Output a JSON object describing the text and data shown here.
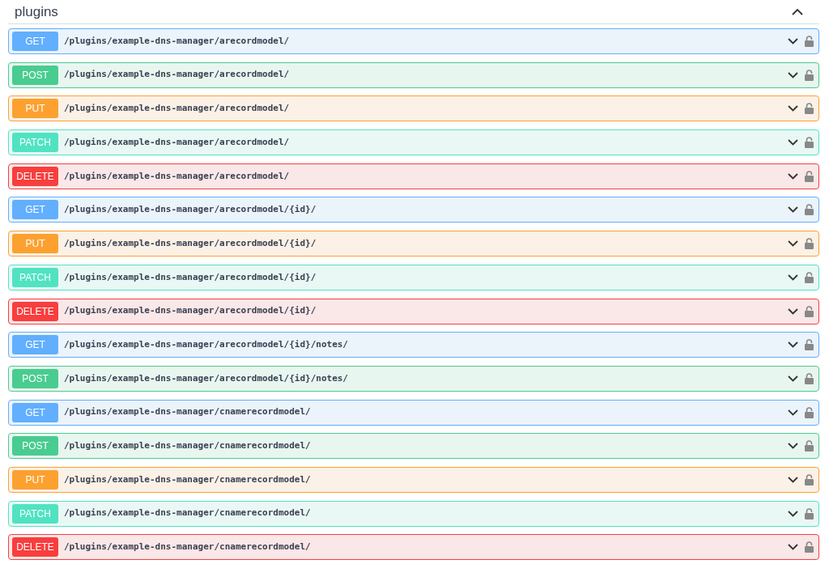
{
  "section": {
    "title": "plugins",
    "expanded": true
  },
  "operations": [
    {
      "kind": "get",
      "method": "GET",
      "path": "/plugins/example-dns-manager/arecordmodel/"
    },
    {
      "kind": "post",
      "method": "POST",
      "path": "/plugins/example-dns-manager/arecordmodel/"
    },
    {
      "kind": "put",
      "method": "PUT",
      "path": "/plugins/example-dns-manager/arecordmodel/"
    },
    {
      "kind": "patch",
      "method": "PATCH",
      "path": "/plugins/example-dns-manager/arecordmodel/"
    },
    {
      "kind": "delete",
      "method": "DELETE",
      "path": "/plugins/example-dns-manager/arecordmodel/"
    },
    {
      "kind": "get",
      "method": "GET",
      "path": "/plugins/example-dns-manager/arecordmodel/{id}/"
    },
    {
      "kind": "put",
      "method": "PUT",
      "path": "/plugins/example-dns-manager/arecordmodel/{id}/"
    },
    {
      "kind": "patch",
      "method": "PATCH",
      "path": "/plugins/example-dns-manager/arecordmodel/{id}/"
    },
    {
      "kind": "delete",
      "method": "DELETE",
      "path": "/plugins/example-dns-manager/arecordmodel/{id}/"
    },
    {
      "kind": "get",
      "method": "GET",
      "path": "/plugins/example-dns-manager/arecordmodel/{id}/notes/"
    },
    {
      "kind": "post",
      "method": "POST",
      "path": "/plugins/example-dns-manager/arecordmodel/{id}/notes/"
    },
    {
      "kind": "get",
      "method": "GET",
      "path": "/plugins/example-dns-manager/cnamerecordmodel/"
    },
    {
      "kind": "post",
      "method": "POST",
      "path": "/plugins/example-dns-manager/cnamerecordmodel/"
    },
    {
      "kind": "put",
      "method": "PUT",
      "path": "/plugins/example-dns-manager/cnamerecordmodel/"
    },
    {
      "kind": "patch",
      "method": "PATCH",
      "path": "/plugins/example-dns-manager/cnamerecordmodel/"
    },
    {
      "kind": "delete",
      "method": "DELETE",
      "path": "/plugins/example-dns-manager/cnamerecordmodel/"
    }
  ]
}
